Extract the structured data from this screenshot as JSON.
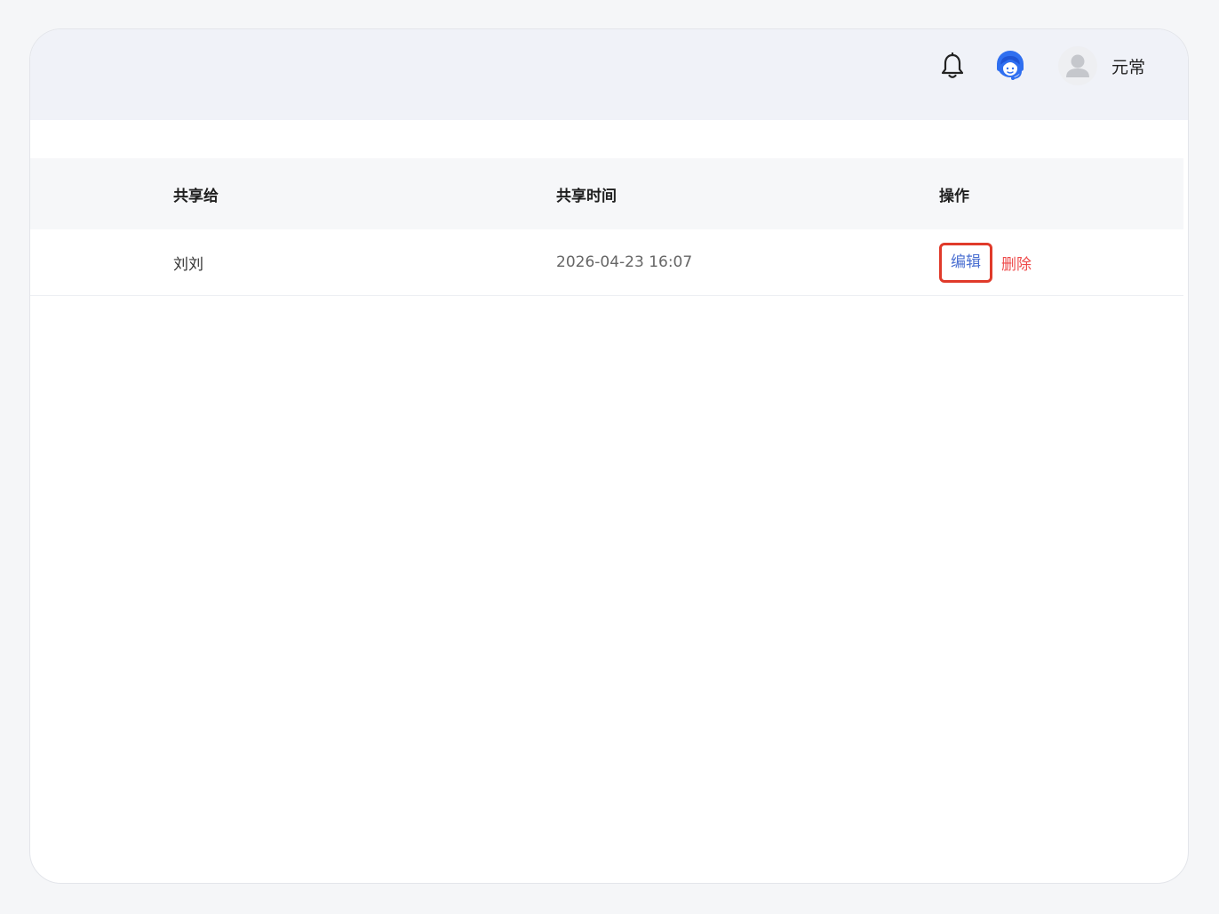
{
  "header": {
    "notification_icon": "bell-icon",
    "support_icon": "customer-service-icon",
    "support_color": "#2f6ff0",
    "user": {
      "avatar_icon": "user-avatar-icon",
      "name": "元常"
    }
  },
  "table": {
    "columns": [
      "共享给",
      "共享时间",
      "操作"
    ],
    "rows": [
      {
        "shared_to": "刘刘",
        "shared_time": "2026-04-23 16:07",
        "actions": {
          "edit": "编辑",
          "delete": "删除"
        }
      }
    ]
  },
  "colors": {
    "edit_link": "#4a6fd1",
    "delete_link": "#ee4b4b",
    "highlight_box": "#e03a2a"
  }
}
